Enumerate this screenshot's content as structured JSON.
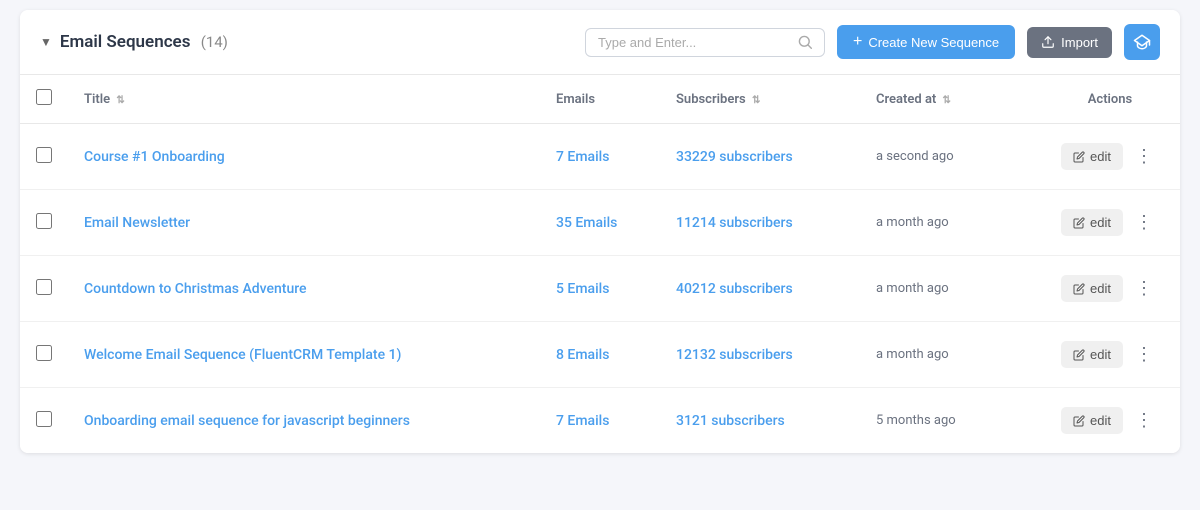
{
  "header": {
    "title": "Email Sequences",
    "count": "(14)",
    "search_placeholder": "Type and Enter...",
    "btn_create_label": "Create New Sequence",
    "btn_import_label": "Import"
  },
  "table": {
    "columns": {
      "title": "Title",
      "emails": "Emails",
      "subscribers": "Subscribers",
      "created_at": "Created at",
      "actions": "Actions"
    },
    "rows": [
      {
        "title": "Course #1 Onboarding",
        "emails": "7 Emails",
        "subscribers": "33229 subscribers",
        "created_at": "a second ago"
      },
      {
        "title": "Email Newsletter",
        "emails": "35 Emails",
        "subscribers": "11214 subscribers",
        "created_at": "a month ago"
      },
      {
        "title": "Countdown to Christmas Adventure",
        "emails": "5 Emails",
        "subscribers": "40212 subscribers",
        "created_at": "a month ago"
      },
      {
        "title": "Welcome Email Sequence (FluentCRM Template 1)",
        "emails": "8 Emails",
        "subscribers": "12132 subscribers",
        "created_at": "a month ago"
      },
      {
        "title": "Onboarding email sequence for javascript beginners",
        "emails": "7 Emails",
        "subscribers": "3121 subscribers",
        "created_at": "5 months ago"
      }
    ],
    "edit_label": "edit"
  }
}
